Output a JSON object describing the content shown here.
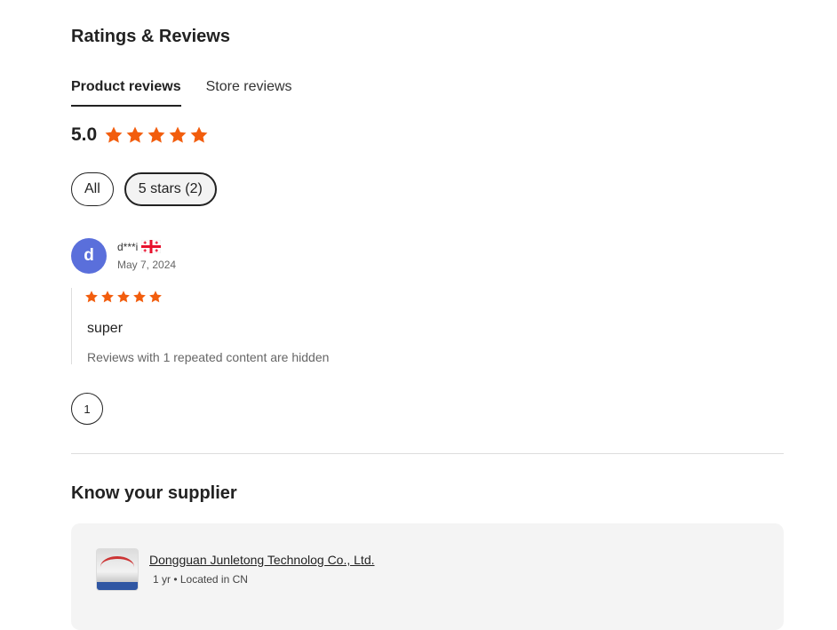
{
  "ratings": {
    "title": "Ratings & Reviews",
    "tabs": [
      {
        "label": "Product reviews",
        "active": true
      },
      {
        "label": "Store reviews",
        "active": false
      }
    ],
    "average_score": "5.0",
    "average_stars": 5,
    "star_color": "#f25d0d",
    "filters": [
      {
        "label": "All",
        "selected": false
      },
      {
        "label": "5 stars (2)",
        "selected": true
      }
    ]
  },
  "review": {
    "avatar_letter": "d",
    "avatar_color": "#5a6fdb",
    "username": "d***i",
    "flag_icon": "georgia-flag-icon",
    "date": "May 7, 2024",
    "stars": 5,
    "text": "super",
    "hidden_note": "Reviews with 1 repeated content are hidden"
  },
  "pagination": {
    "current_page": "1"
  },
  "supplier": {
    "title": "Know your supplier",
    "name": "Dongguan Junletong Technolog Co., Ltd.",
    "meta": "1 yr • Located in CN",
    "logo_icon": "supplier-logo-image"
  }
}
